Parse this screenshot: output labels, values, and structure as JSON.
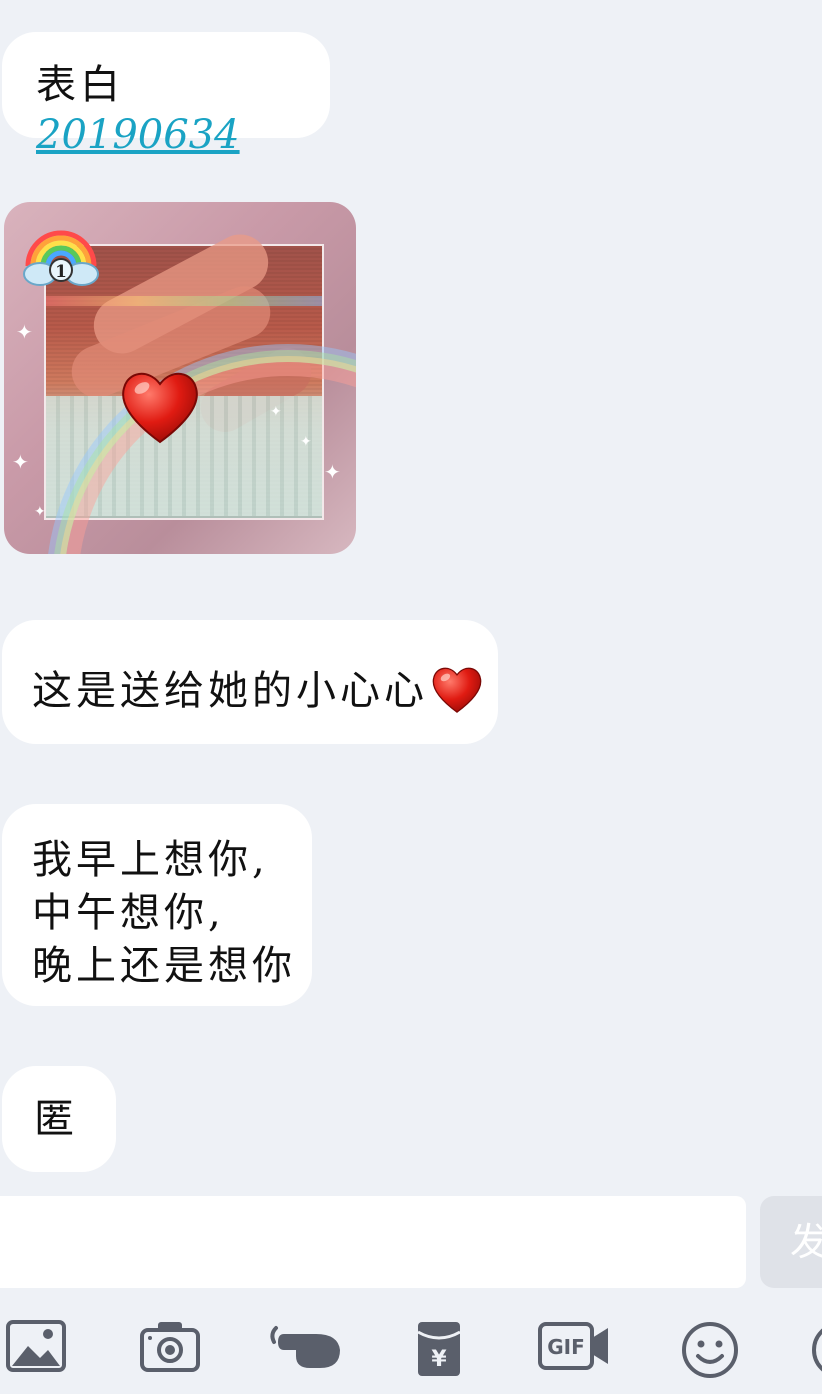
{
  "messages": {
    "m1": {
      "prefix": "表白",
      "link": "20190634"
    },
    "m3": {
      "text": "这是送给她的小心心"
    },
    "m4": {
      "line1": "我早上想你,",
      "line2": "中午想你,",
      "line3": "晚上还是想你"
    },
    "m5": {
      "text": "匿"
    }
  },
  "image_message": {
    "badge_number": "1"
  },
  "composer": {
    "input_value": "",
    "send_label": "发"
  },
  "toolbar": {
    "icons": [
      "image-icon",
      "camera-icon",
      "hongbao-hand-icon",
      "red-packet-icon",
      "gif-icon",
      "emoji-icon",
      "more-icon"
    ],
    "gif_label": "GIF",
    "yen_label": "¥"
  },
  "colors": {
    "background": "#eef1f6",
    "bubble": "#ffffff",
    "link": "#1aa3c4",
    "icon": "#5a5f6b"
  }
}
